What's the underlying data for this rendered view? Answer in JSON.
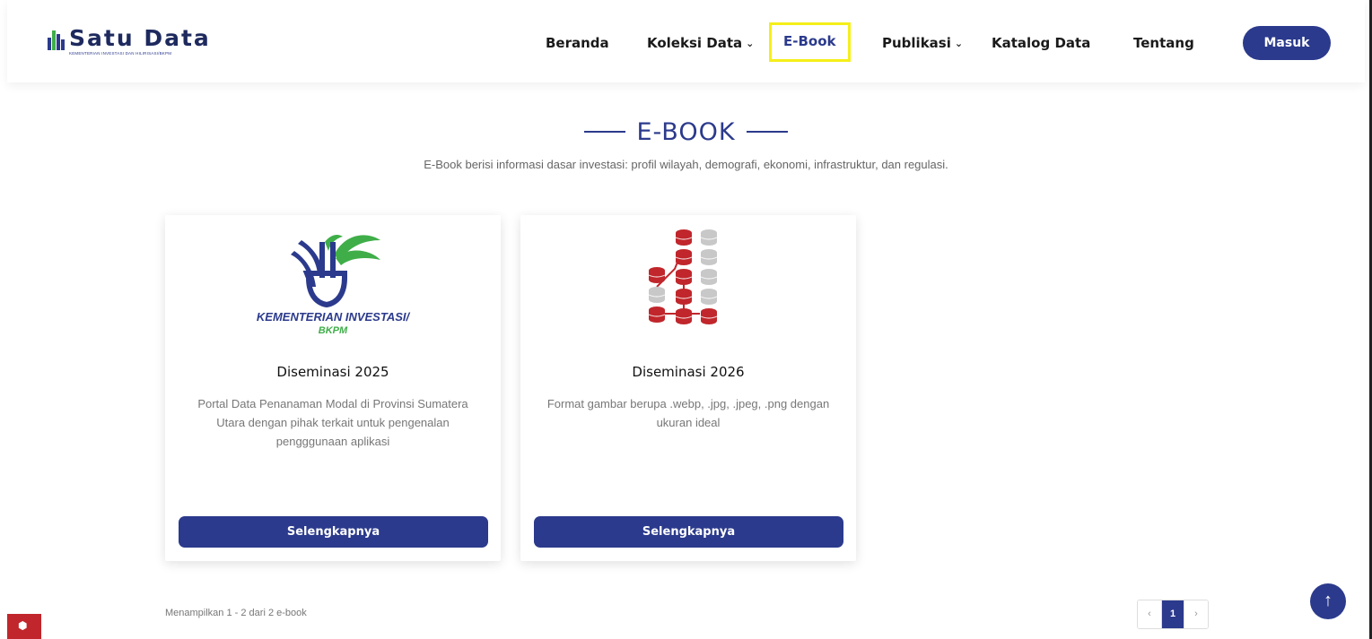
{
  "brand": {
    "title": "Satu Data",
    "subtitle": "KEMENTERIAN INVESTASI DAN HILIRISASI/BKPM"
  },
  "nav": {
    "beranda": "Beranda",
    "koleksi": "Koleksi Data",
    "ebook": "E-Book",
    "publikasi": "Publikasi",
    "katalog": "Katalog Data",
    "tentang": "Tentang",
    "login": "Masuk",
    "chevron": "⌄"
  },
  "section": {
    "title": "E-BOOK",
    "description": "E-Book berisi informasi dasar investasi: profil wilayah, demografi, ekonomi, infrastruktur, dan regulasi."
  },
  "cards": [
    {
      "logo_line1": "KEMENTERIAN INVESTASI/",
      "logo_line2": "BKPM",
      "title": "Diseminasi 2025",
      "text": "Portal Data Penanaman Modal di Provinsi Sumatera Utara dengan pihak terkait untuk pengenalan pengggunaan aplikasi",
      "button": "Selengkapnya"
    },
    {
      "title": "Diseminasi 2026",
      "text": "Format gambar berupa .webp, .jpg, .jpeg, .png dengan ukuran ideal",
      "button": "Selengkapnya"
    }
  ],
  "footer": {
    "showing": "Menampilkan 1 - 2 dari 2 e-book",
    "prev": "‹",
    "page": "1",
    "next": "›",
    "back_to_top": "↑"
  },
  "colors": {
    "primary": "#2b3a8c",
    "highlight": "#f5ef19",
    "db_red": "#c0262b",
    "db_gray": "#c8c8c8",
    "logo_green": "#3fae49"
  }
}
